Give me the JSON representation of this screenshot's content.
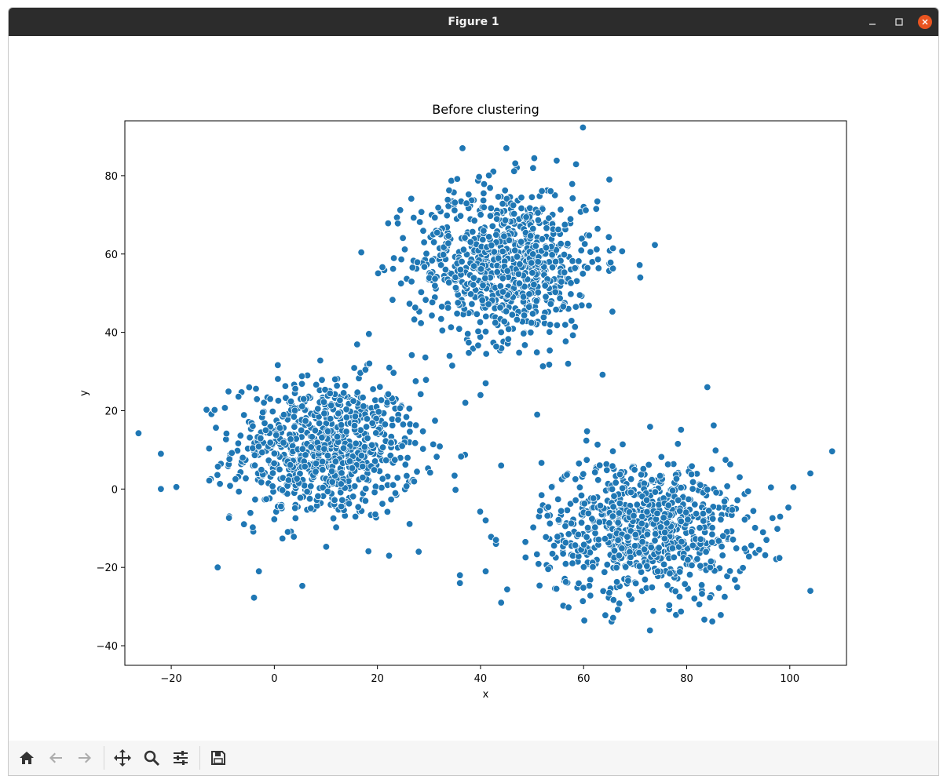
{
  "window": {
    "title": "Figure 1",
    "controls": [
      "minimize-icon",
      "maximize-icon",
      "close-icon"
    ]
  },
  "toolbar": {
    "items": [
      {
        "name": "home-icon",
        "enabled": true
      },
      {
        "name": "back-arrow-icon",
        "enabled": false
      },
      {
        "name": "forward-arrow-icon",
        "enabled": false
      },
      {
        "name": "pan-icon",
        "enabled": true
      },
      {
        "name": "zoom-icon",
        "enabled": true
      },
      {
        "name": "configure-subplots-icon",
        "enabled": true
      },
      {
        "name": "save-icon",
        "enabled": true
      }
    ]
  },
  "colors": {
    "marker": "#1f77b4",
    "marker_edge": "#ffffff",
    "titlebar": "#2c2c2c",
    "close_button": "#e95420"
  },
  "chart_data": {
    "type": "scatter",
    "title": "Before clustering",
    "xlabel": "x",
    "ylabel": "y",
    "xlim": [
      -29,
      111
    ],
    "ylim": [
      -45,
      94
    ],
    "xticks": [
      -20,
      0,
      20,
      40,
      60,
      80,
      100
    ],
    "yticks": [
      -40,
      -20,
      0,
      20,
      40,
      60,
      80
    ],
    "xtick_labels": [
      "−20",
      "0",
      "20",
      "40",
      "60",
      "80",
      "100"
    ],
    "ytick_labels": [
      "−40",
      "−20",
      "0",
      "20",
      "40",
      "60",
      "80"
    ],
    "grid": false,
    "clusters": [
      {
        "center": [
          10,
          10
        ],
        "std": [
          9,
          9
        ],
        "count": 800
      },
      {
        "center": [
          45,
          58
        ],
        "std": [
          9,
          10
        ],
        "count": 800
      },
      {
        "center": [
          72,
          -10
        ],
        "std": [
          10,
          9
        ],
        "count": 800
      }
    ],
    "outliers": [
      [
        -22,
        9
      ],
      [
        -22,
        0
      ],
      [
        -19,
        0.5
      ],
      [
        -11,
        -20
      ],
      [
        -3,
        -21
      ],
      [
        28,
        -16
      ],
      [
        36,
        -22
      ],
      [
        36,
        -24
      ],
      [
        41,
        -21
      ],
      [
        44,
        -29
      ],
      [
        43,
        -14
      ],
      [
        104,
        -26
      ],
      [
        104,
        4
      ],
      [
        84,
        26
      ],
      [
        40,
        24
      ],
      [
        34,
        34
      ],
      [
        36.5,
        87
      ],
      [
        45,
        87
      ],
      [
        65,
        79
      ],
      [
        71,
        54
      ],
      [
        57,
        32
      ],
      [
        41,
        27
      ],
      [
        44,
        6
      ],
      [
        41,
        -8
      ],
      [
        43,
        -13
      ],
      [
        51,
        19
      ]
    ]
  }
}
